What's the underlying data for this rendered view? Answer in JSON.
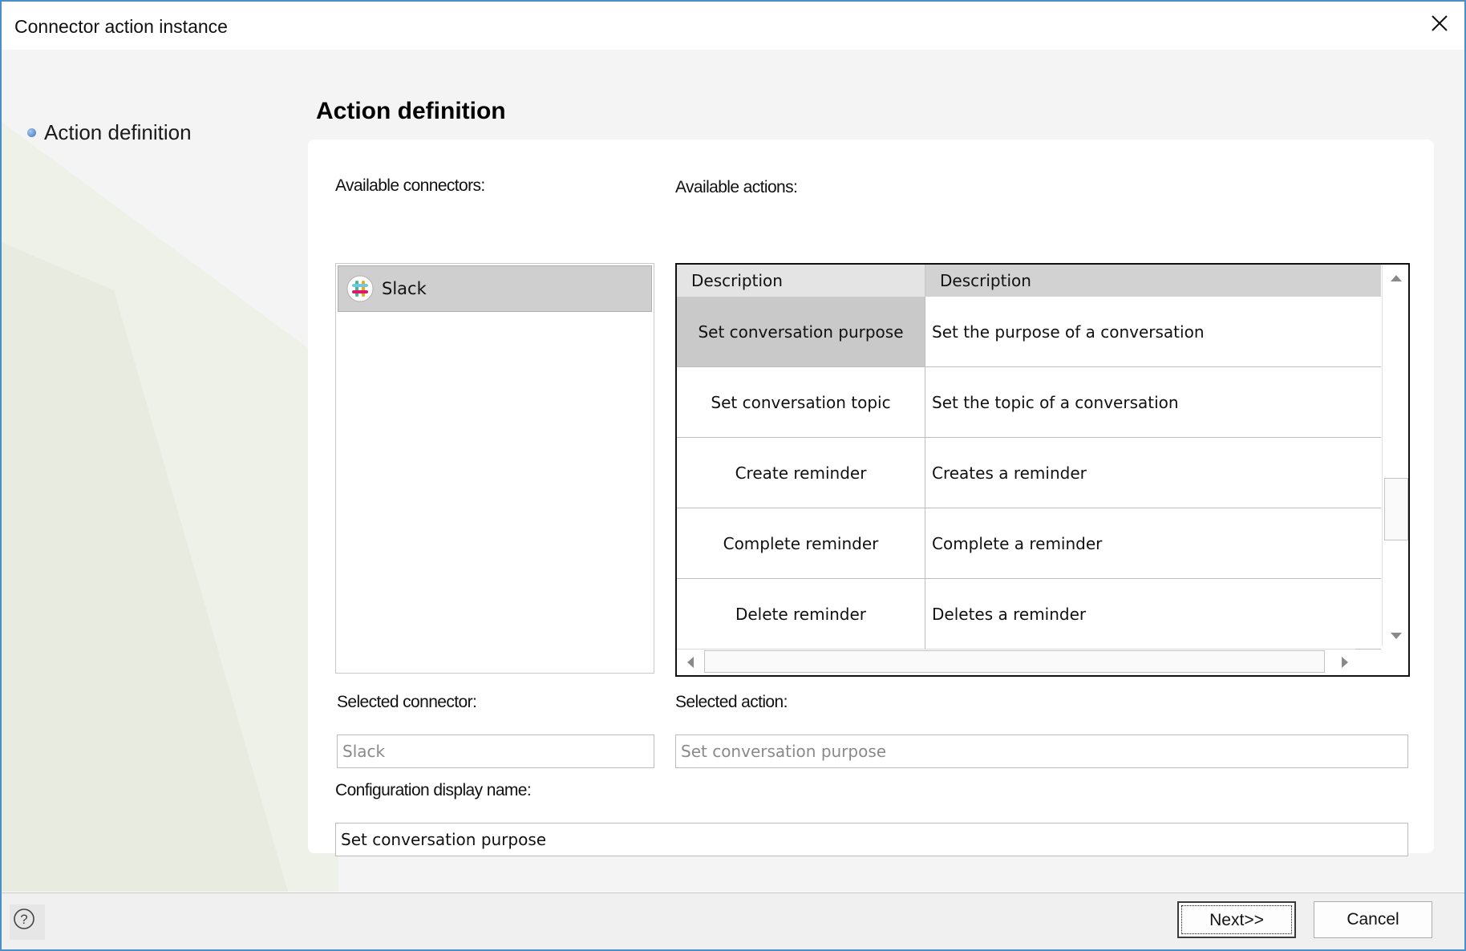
{
  "window": {
    "title": "Connector action instance"
  },
  "icons": {
    "close": "close-icon",
    "nav_bullet": "bullet-icon",
    "slack": "slack-logo-icon",
    "help": "help-icon",
    "scroll_up": "arrow-up-icon",
    "scroll_down": "arrow-down-icon",
    "scroll_left": "arrow-left-icon",
    "scroll_right": "arrow-right-icon"
  },
  "sidebar": {
    "steps": [
      {
        "label": "Action definition"
      }
    ]
  },
  "main": {
    "heading": "Action definition",
    "available_connectors_label": "Available connectors:",
    "available_actions_label": "Available actions:",
    "connectors": [
      {
        "label": "Slack"
      }
    ],
    "actions_grid": {
      "columns": [
        "Description",
        "Description"
      ],
      "rows": [
        {
          "name": "Set conversation purpose",
          "description": "Set the purpose of a conversation"
        },
        {
          "name": "Set conversation topic",
          "description": "Set the topic of a conversation"
        },
        {
          "name": "Create reminder",
          "description": "Creates a reminder"
        },
        {
          "name": "Complete reminder",
          "description": "Complete a reminder"
        },
        {
          "name": "Delete reminder",
          "description": "Deletes a reminder"
        }
      ]
    },
    "selected_connector_label": "Selected connector:",
    "selected_connector_value": "Slack",
    "selected_action_label": "Selected action:",
    "selected_action_value": "Set conversation purpose",
    "config_name_label": "Configuration display name:",
    "config_name_value": "Set conversation purpose"
  },
  "footer": {
    "next_label": "Next>>",
    "cancel_label": "Cancel"
  },
  "colors": {
    "window_border": "#4a90c8",
    "selection": "#c9c9c9",
    "header": "#d6d6d6"
  }
}
